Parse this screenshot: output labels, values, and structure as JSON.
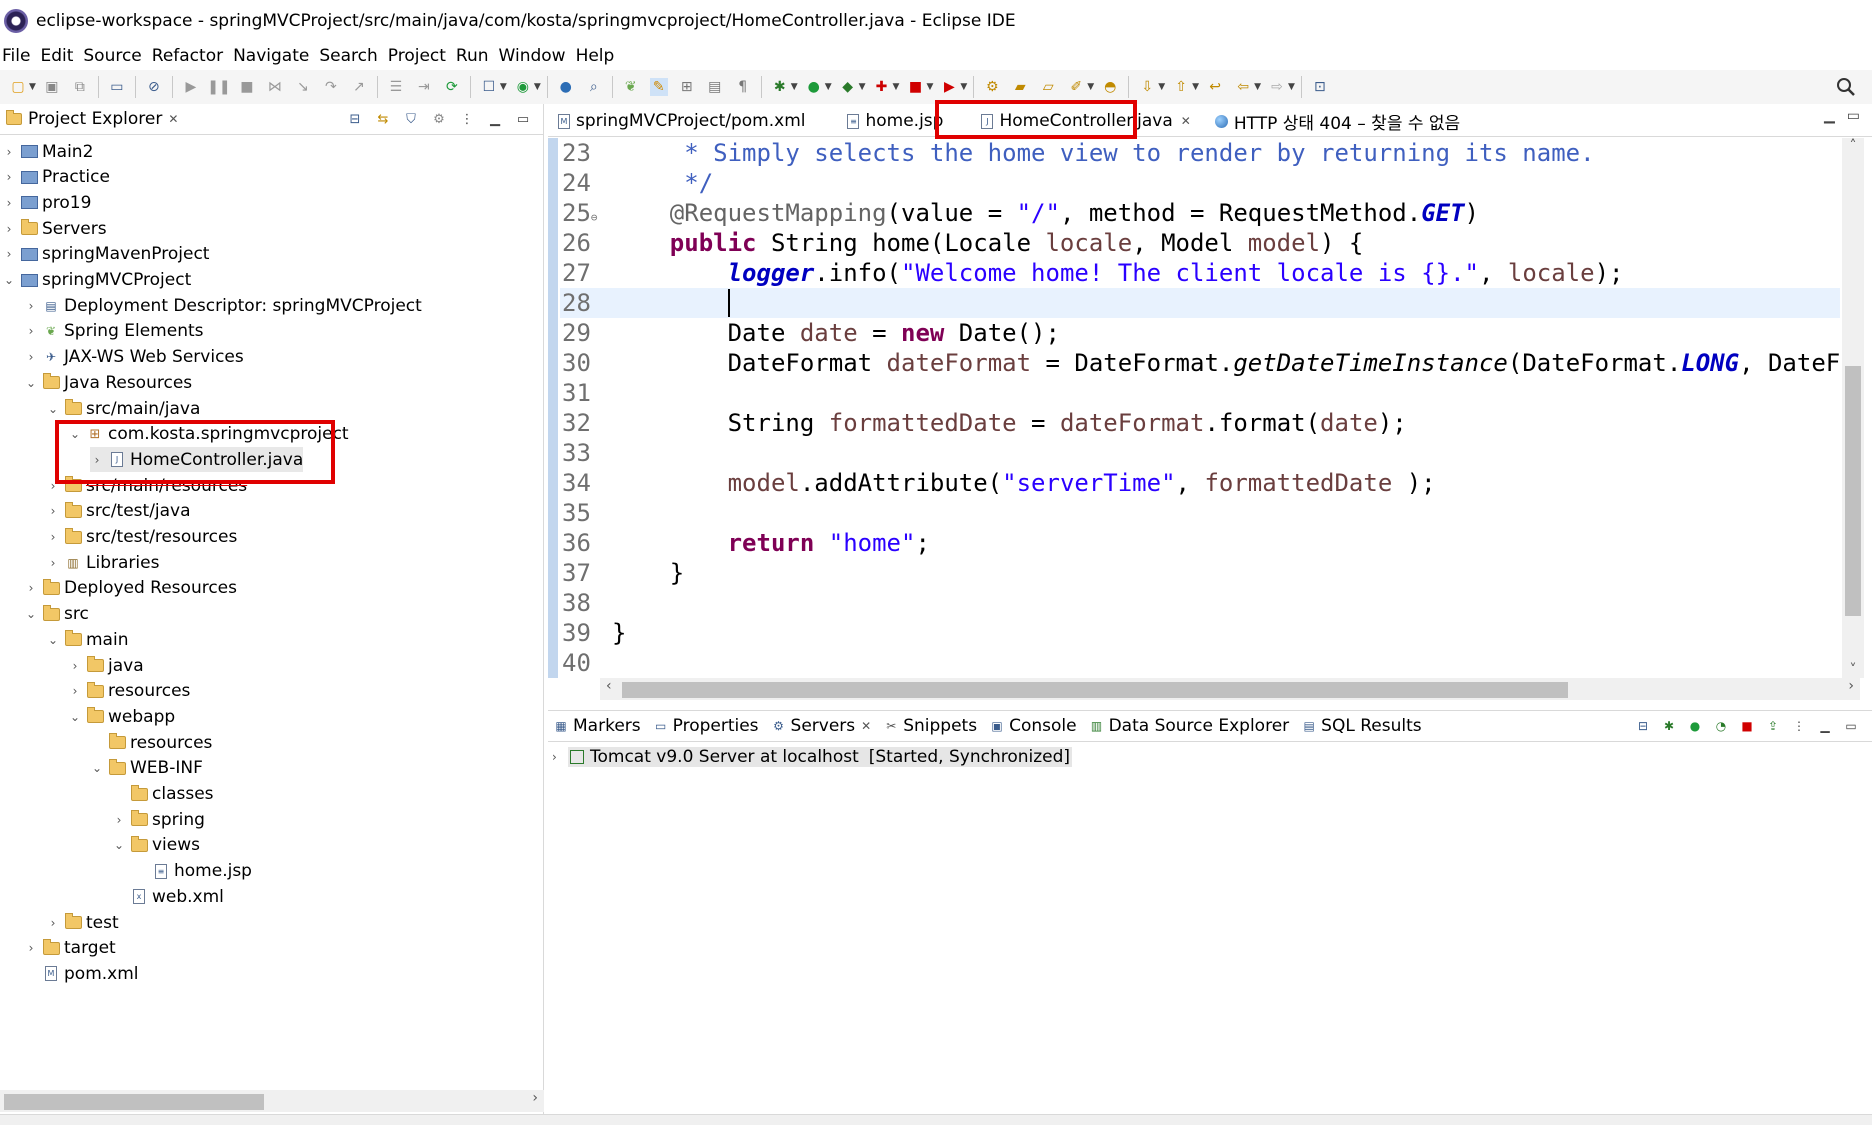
{
  "window": {
    "title": "eclipse-workspace - springMVCProject/src/main/java/com/kosta/springmvcproject/HomeController.java - Eclipse IDE"
  },
  "menu": [
    "File",
    "Edit",
    "Source",
    "Refactor",
    "Navigate",
    "Search",
    "Project",
    "Run",
    "Window",
    "Help"
  ],
  "project_explorer": {
    "title": "Project Explorer",
    "close": "✕",
    "tree": [
      {
        "label": "Main2",
        "chev": "›",
        "icon": "project-icon"
      },
      {
        "label": "Practice",
        "chev": "›",
        "icon": "project-icon"
      },
      {
        "label": "pro19",
        "chev": "›",
        "icon": "project-icon"
      },
      {
        "label": "Servers",
        "chev": "›",
        "icon": "folder-icon"
      },
      {
        "label": "springMavenProject",
        "chev": "›",
        "icon": "project-icon"
      },
      {
        "label": "springMVCProject",
        "chev": "⌄",
        "icon": "project-icon"
      },
      {
        "label": "Deployment Descriptor: springMVCProject",
        "chev": "›",
        "icon": "descriptor-icon"
      },
      {
        "label": "Spring Elements",
        "chev": "›",
        "icon": "spring-icon"
      },
      {
        "label": "JAX-WS Web Services",
        "chev": "›",
        "icon": "webservice-icon"
      },
      {
        "label": "Java Resources",
        "chev": "⌄",
        "icon": "java-resources-icon"
      },
      {
        "label": "src/main/java",
        "chev": "⌄",
        "icon": "source-folder-icon"
      },
      {
        "label": "com.kosta.springmvcproject",
        "chev": "⌄",
        "icon": "package-icon"
      },
      {
        "label": "HomeController.java",
        "chev": "›",
        "icon": "java-file-icon"
      },
      {
        "label": "src/main/resources",
        "chev": "›",
        "icon": "source-folder-icon"
      },
      {
        "label": "src/test/java",
        "chev": "›",
        "icon": "source-folder-icon"
      },
      {
        "label": "src/test/resources",
        "chev": "›",
        "icon": "source-folder-icon"
      },
      {
        "label": "Libraries",
        "chev": "›",
        "icon": "library-icon"
      },
      {
        "label": "Deployed Resources",
        "chev": "›",
        "icon": "folder-icon"
      },
      {
        "label": "src",
        "chev": "⌄",
        "icon": "folder-icon"
      },
      {
        "label": "main",
        "chev": "⌄",
        "icon": "folder-icon"
      },
      {
        "label": "java",
        "chev": "›",
        "icon": "folder-icon"
      },
      {
        "label": "resources",
        "chev": "›",
        "icon": "folder-icon"
      },
      {
        "label": "webapp",
        "chev": "⌄",
        "icon": "folder-icon"
      },
      {
        "label": "resources",
        "chev": "",
        "icon": "folder-icon"
      },
      {
        "label": "WEB-INF",
        "chev": "⌄",
        "icon": "folder-icon"
      },
      {
        "label": "classes",
        "chev": "",
        "icon": "folder-icon"
      },
      {
        "label": "spring",
        "chev": "›",
        "icon": "folder-icon"
      },
      {
        "label": "views",
        "chev": "⌄",
        "icon": "folder-icon"
      },
      {
        "label": "home.jsp",
        "chev": "",
        "icon": "file-icon"
      },
      {
        "label": "web.xml",
        "chev": "",
        "icon": "xml-file-icon"
      },
      {
        "label": "test",
        "chev": "›",
        "icon": "folder-icon"
      },
      {
        "label": "target",
        "chev": "›",
        "icon": "folder-icon"
      },
      {
        "label": "pom.xml",
        "chev": "",
        "icon": "maven-file-icon"
      }
    ]
  },
  "editor": {
    "tabs": [
      {
        "label": "springMVCProject/pom.xml",
        "icon": "M"
      },
      {
        "label": "home.jsp",
        "icon": ""
      },
      {
        "label": "HomeController.java",
        "icon": "J",
        "close": "✕"
      },
      {
        "label": "HTTP 상태 404 – 찾을 수 없음",
        "icon": "globe"
      }
    ],
    "line_numbers": [
      "23",
      "24",
      "25",
      "26",
      "27",
      "28",
      "29",
      "30",
      "31",
      "32",
      "33",
      "34",
      "35",
      "36",
      "37",
      "38",
      "39",
      "40"
    ],
    "line_marks": {
      "25": "⊖"
    }
  },
  "bottom_panel": {
    "tabs": [
      "Markers",
      "Properties",
      "Servers",
      "Snippets",
      "Console",
      "Data Source Explorer",
      "SQL Results"
    ],
    "servers_close": "✕",
    "server_entry": {
      "name": "Tomcat v9.0 Server at localhost",
      "status": "[Started, Synchronized]"
    }
  },
  "colors": {
    "highlight_red": "#e00000",
    "keyword": "#7f0055",
    "string": "#2a00ff",
    "comment": "#3f5fbf",
    "field": "#0000c0",
    "current_line": "#e8f2fe"
  }
}
